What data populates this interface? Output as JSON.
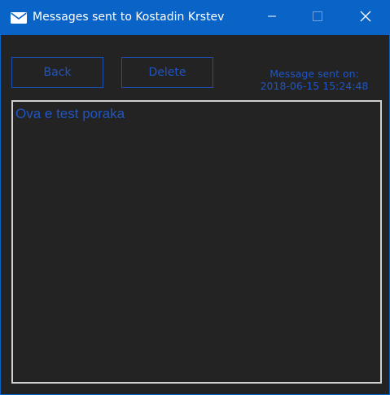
{
  "window": {
    "title": "Messages sent to Kostadin Krstev",
    "icon": "mail-icon",
    "controls": [
      "minimize-icon",
      "maximize-icon",
      "close-icon"
    ]
  },
  "toolbar": {
    "back_label": "Back",
    "delete_label": "Delete"
  },
  "sent_info": {
    "label": "Message sent on:",
    "datetime": "2018-06-15 15:24:48"
  },
  "message": {
    "text": "Ova e test poraka"
  },
  "colors": {
    "titlebar": "#0a64c8",
    "background": "#232323",
    "accent_text": "#1f55c4",
    "button_border": "#1c4fb0",
    "textbox_border": "#d0d0d0"
  }
}
